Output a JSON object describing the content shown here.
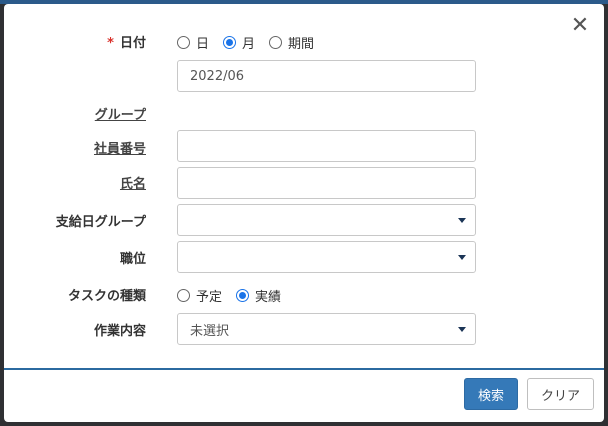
{
  "close_icon": "close-icon",
  "date": {
    "required_mark": "*",
    "label": "日付",
    "options": [
      {
        "label": "日",
        "selected": false
      },
      {
        "label": "月",
        "selected": true
      },
      {
        "label": "期間",
        "selected": false
      }
    ],
    "value": "2022/06"
  },
  "group": {
    "label": "グループ"
  },
  "employee_no": {
    "label": "社員番号",
    "value": ""
  },
  "name": {
    "label": "氏名",
    "value": ""
  },
  "pay_group": {
    "label": "支給日グループ",
    "value": ""
  },
  "position": {
    "label": "職位",
    "value": ""
  },
  "task_type": {
    "label": "タスクの種類",
    "options": [
      {
        "label": "予定",
        "selected": false
      },
      {
        "label": "実績",
        "selected": true
      }
    ]
  },
  "work": {
    "label": "作業内容",
    "value": "未選択"
  },
  "footer": {
    "search_label": "検索",
    "clear_label": "クリア"
  },
  "colors": {
    "primary": "#3579b8",
    "required": "#d9302a",
    "accent_line": "#2b6aa0"
  }
}
